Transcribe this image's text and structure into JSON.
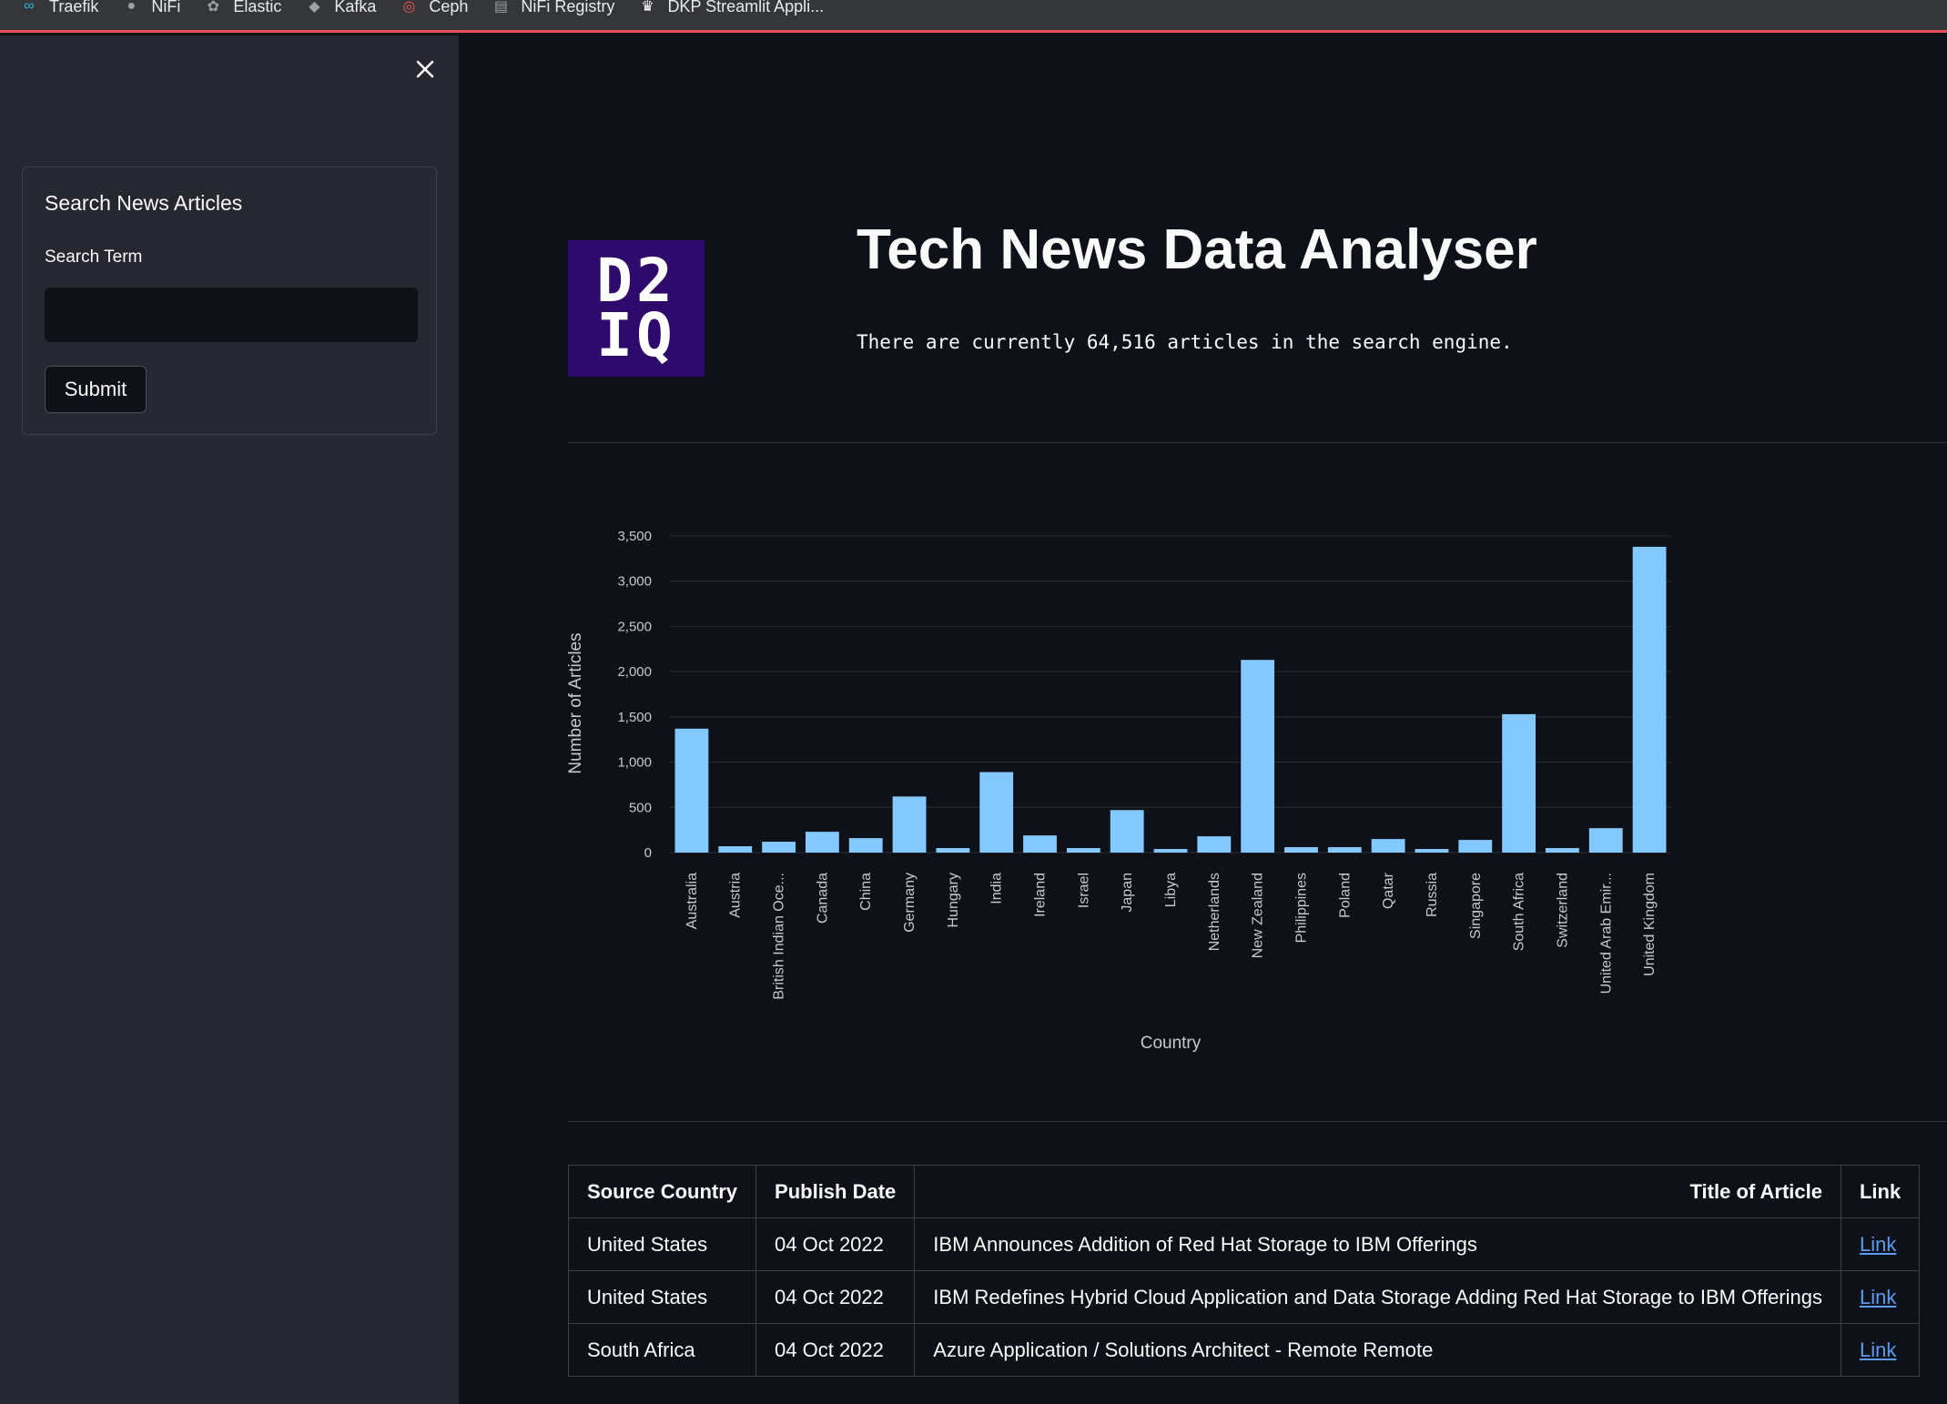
{
  "bookmarks": [
    {
      "label": "Traefik",
      "icon": "traefik-icon"
    },
    {
      "label": "NiFi",
      "icon": "nifi-icon"
    },
    {
      "label": "Elastic",
      "icon": "elastic-icon"
    },
    {
      "label": "Kafka",
      "icon": "kafka-icon"
    },
    {
      "label": "Ceph",
      "icon": "ceph-icon"
    },
    {
      "label": "NiFi Registry",
      "icon": "nifi-registry-icon"
    },
    {
      "label": "DKP Streamlit Appli...",
      "icon": "crown-icon"
    }
  ],
  "sidebar": {
    "form_title": "Search News Articles",
    "search_label": "Search Term",
    "search_value": "",
    "submit_label": "Submit"
  },
  "header": {
    "logo_line1": "D2",
    "logo_line2": "IQ",
    "title": "Tech News Data Analyser",
    "subtitle": "There are currently 64,516 articles in the search engine."
  },
  "chart_data": {
    "type": "bar",
    "categories": [
      "Australia",
      "Austria",
      "British Indian Oce...",
      "Canada",
      "China",
      "Germany",
      "Hungary",
      "India",
      "Ireland",
      "Israel",
      "Japan",
      "Libya",
      "Netherlands",
      "New Zealand",
      "Philippines",
      "Poland",
      "Qatar",
      "Russia",
      "Singapore",
      "South Africa",
      "Switzerland",
      "United Arab Emir...",
      "United Kingdom"
    ],
    "values": [
      1370,
      70,
      120,
      230,
      160,
      620,
      50,
      890,
      190,
      50,
      470,
      40,
      180,
      2130,
      60,
      60,
      150,
      40,
      140,
      1530,
      50,
      270,
      3380
    ],
    "yticks": [
      0,
      500,
      1000,
      1500,
      2000,
      2500,
      3000,
      3500
    ],
    "ytick_labels": [
      "0",
      "500",
      "1,000",
      "1,500",
      "2,000",
      "2,500",
      "3,000",
      "3,500"
    ],
    "ylim": [
      0,
      3500
    ],
    "xlabel": "Country",
    "ylabel": "Number of Articles",
    "color": "#83c9ff",
    "grid": true
  },
  "table": {
    "headers": [
      "Source Country",
      "Publish Date",
      "Title of Article",
      "Link"
    ],
    "rows": [
      [
        "United States",
        "04 Oct 2022",
        "IBM Announces Addition of Red Hat Storage to IBM Offerings",
        "Link"
      ],
      [
        "United States",
        "04 Oct 2022",
        "IBM Redefines Hybrid Cloud Application and Data Storage Adding Red Hat Storage to IBM Offerings",
        "Link"
      ],
      [
        "South Africa",
        "04 Oct 2022",
        "Azure Application / Solutions Architect - Remote Remote",
        "Link"
      ]
    ]
  },
  "colors": {
    "background": "#0e1117",
    "sidebar": "#262730",
    "accent_bar": "#83c9ff",
    "link": "#5b9bf3",
    "logo_bg": "#2d0a6b"
  }
}
